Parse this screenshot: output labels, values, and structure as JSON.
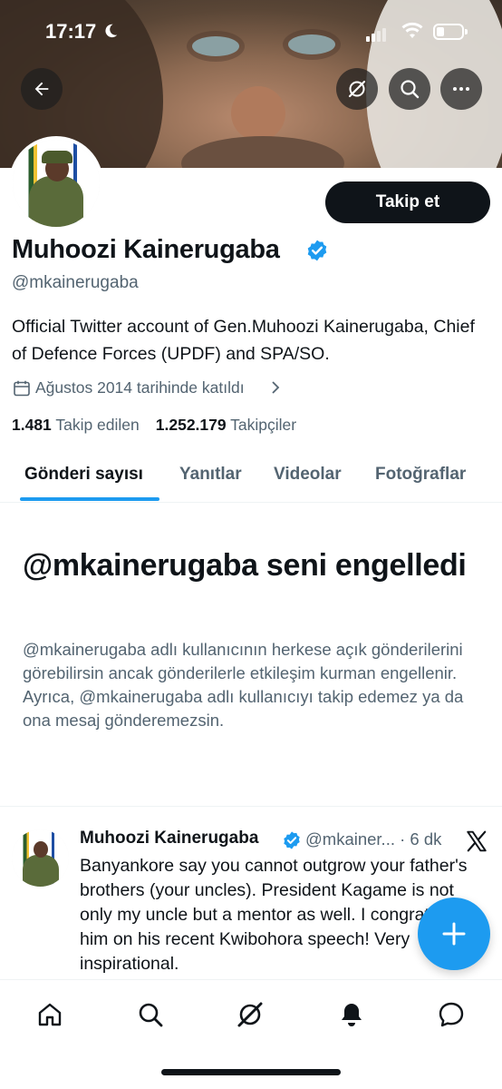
{
  "status_bar": {
    "time": "17:17"
  },
  "profile": {
    "follow_label": "Takip et",
    "display_name": "Muhoozi Kainerugaba",
    "handle": "@mkainerugaba",
    "bio": "Official Twitter account of Gen.Muhoozi Kainerugaba, Chief of Defence Forces (UPDF) and SPA/SO.",
    "joined": "Ağustos 2014 tarihinde katıldı",
    "following_count": "1.481",
    "following_label": "Takip edilen",
    "followers_count": "1.252.179",
    "followers_label": "Takipçiler"
  },
  "tabs": [
    {
      "label": "Gönderi sayısı",
      "active": true
    },
    {
      "label": "Yanıtlar"
    },
    {
      "label": "Videolar"
    },
    {
      "label": "Fotoğraflar"
    }
  ],
  "blocked": {
    "title": "@mkainerugaba seni engelledi",
    "description": "@mkainerugaba adlı kullanıcının herkese açık gönderilerini görebilirsin ancak gönderilerle etkileşim kurman engellenir. Ayrıca, @mkainerugaba adlı kullanıcıyı takip edemez ya da ona mesaj gönderemezsin."
  },
  "post": {
    "author": "Muhoozi Kainerugaba",
    "meta": "@mkainer... · 6 dk",
    "text": "Banyankore say you cannot outgrow your father's brothers (your uncles).  President Kagame is not only my uncle but a mentor as well. I congratulate him on his recent Kwibohora speech! Very inspirational."
  },
  "icons": {
    "back": "back-arrow-icon",
    "grok": "grok-icon",
    "search": "search-icon",
    "more": "more-icon",
    "verified": "verified-badge-icon",
    "calendar": "calendar-icon",
    "x_logo": "x-logo-icon",
    "compose": "plus-icon",
    "nav": [
      "home-icon",
      "search-icon",
      "grok-icon",
      "bell-icon",
      "messages-icon"
    ]
  },
  "colors": {
    "accent": "#1d9bf0",
    "text": "#0f1419",
    "muted": "#536471"
  }
}
